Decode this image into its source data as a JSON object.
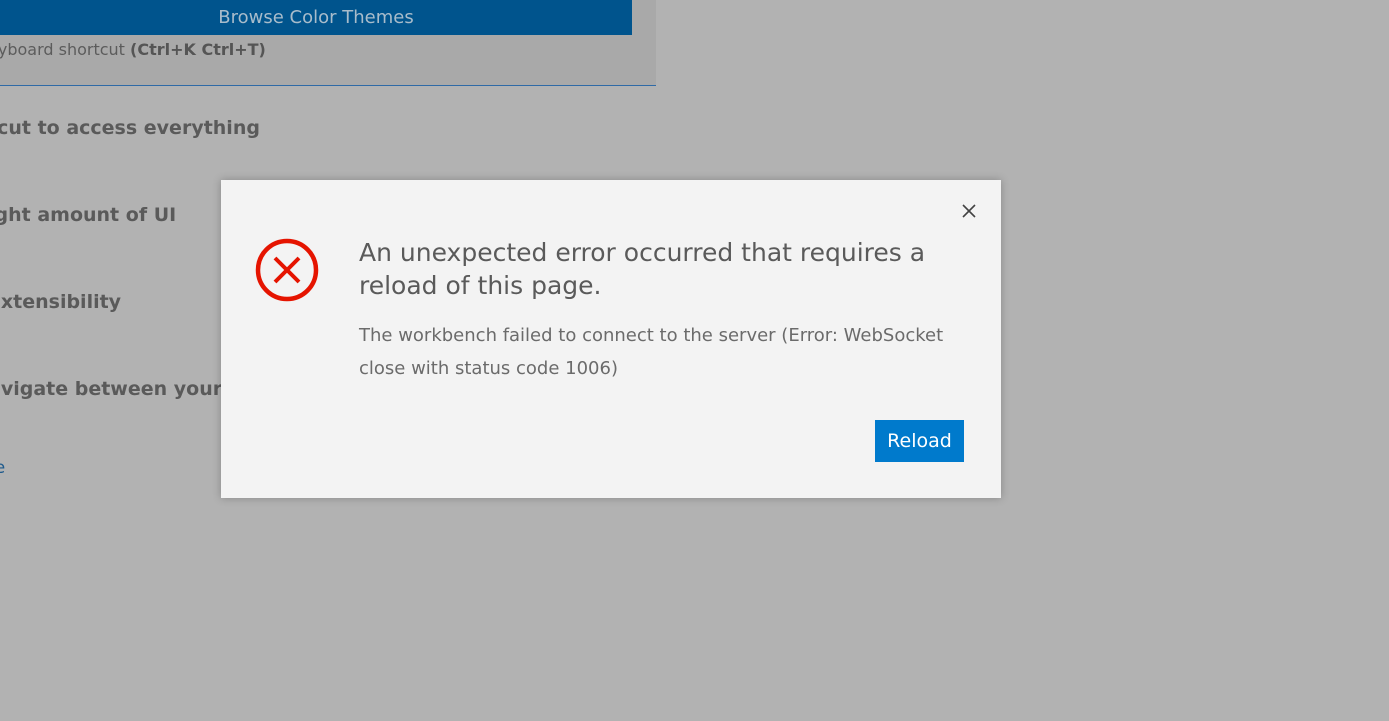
{
  "background": {
    "browse_button_label": "Browse Color Themes",
    "shortcut_text": "eyboard shortcut ",
    "shortcut_keys": "(Ctrl+K Ctrl+T)",
    "items": [
      "tcut to access everything",
      "ight amount of UI",
      "extensibility",
      "avigate between your fil"
    ],
    "link_fragment": "ne"
  },
  "dialog": {
    "title": "An unexpected error occurred that requires a reload of this page.",
    "detail": "The workbench failed to connect to the server (Error: WebSocket close with status code 1006)",
    "reload_label": "Reload",
    "close_icon": "close-icon",
    "status_icon": "error-icon",
    "colors": {
      "error": "#e51400",
      "button": "#007acc"
    }
  }
}
